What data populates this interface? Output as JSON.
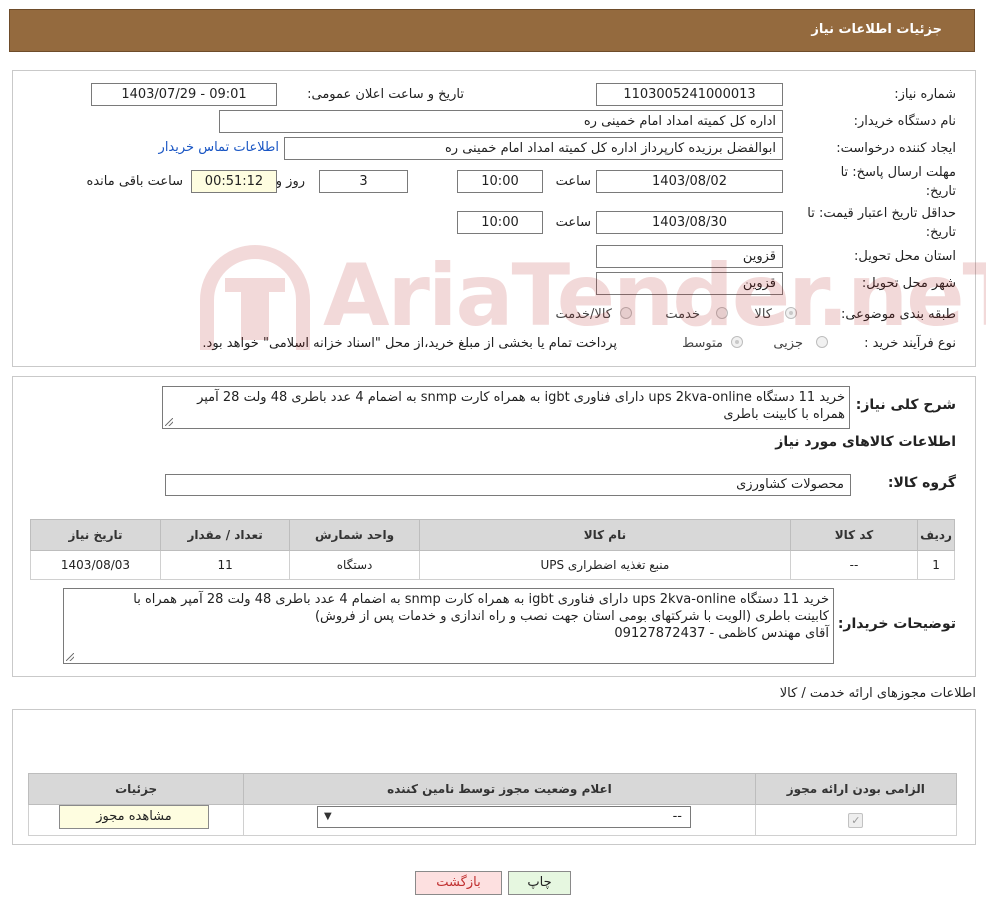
{
  "header": {
    "title": "جزئیات اطلاعات نیاز"
  },
  "need": {
    "need_number_label": "شماره نیاز:",
    "need_number": "1103005241000013",
    "announce_label": "تاریخ و ساعت اعلان عمومی:",
    "announce_value": "1403/07/29 - 09:01",
    "buyer_org_label": "نام دستگاه خریدار:",
    "buyer_org": "اداره کل کمیته امداد امام خمینی  ره",
    "creator_label": "ایجاد کننده درخواست:",
    "creator": "ابوالفضل برزیده کارپرداز اداره کل کمیته امداد امام خمینی  ره",
    "contact_link": "اطلاعات تماس خریدار",
    "deadline_label_1": "مهلت ارسال پاسخ: تا",
    "deadline_label_2": "تاریخ:",
    "deadline_date": "1403/08/02",
    "time_label": "ساعت",
    "deadline_time": "10:00",
    "days_value": "3",
    "days_label": "روز و",
    "remaining_value": "00:51:12",
    "remaining_label": "ساعت باقی مانده",
    "validity_label_1": "حداقل تاریخ اعتبار قیمت: تا",
    "validity_label_2": "تاریخ:",
    "validity_date": "1403/08/30",
    "validity_time": "10:00",
    "province_label": "استان محل تحویل:",
    "province": "قزوین",
    "city_label": "شهر محل تحویل:",
    "city": "قزوین",
    "category_label": "طبقه بندی موضوعی:",
    "category_options": [
      "کالا",
      "خدمت",
      "کالا/خدمت"
    ],
    "purchase_type_label": "نوع فرآیند خرید :",
    "purchase_type_options": [
      "جزیی",
      "متوسط"
    ],
    "purchase_note": "پرداخت تمام یا بخشی از مبلغ خرید،از محل \"اسناد خزانه اسلامی\" خواهد بود."
  },
  "summary": {
    "label": "شرح کلی نیاز:",
    "text": "خرید 11 دستگاه ups 2kva-online دارای فناوری igbt به همراه کارت snmp به اضمام 4 عدد باطری 48 ولت 28 آمپر همراه با کابینت باطری",
    "goods_info_title": "اطلاعات کالاهای مورد نیاز",
    "goods_group_label": "گروه کالا:",
    "goods_group": "محصولات کشاورزی"
  },
  "goods_table": {
    "headers": [
      "ردیف",
      "کد کالا",
      "نام کالا",
      "واحد شمارش",
      "تعداد / مقدار",
      "تاریخ نیاز"
    ],
    "rows": [
      [
        "1",
        "--",
        "منبع تغذیه اضطراری UPS",
        "دستگاه",
        "11",
        "1403/08/03"
      ]
    ]
  },
  "buyer_notes": {
    "label": "توضیحات خریدار:",
    "line1": "خرید 11 دستگاه ups 2kva-online دارای فناوری igbt به همراه کارت snmp به اضمام 4 عدد باطری 48 ولت 28 آمپر همراه با",
    "line2": "کابینت باطری (الویت با شرکتهای بومی استان جهت نصب و راه اندازی و خدمات پس از فروش)",
    "line3": "آقای مهندس کاظمی - 09127872437"
  },
  "licenses": {
    "title": "اطلاعات مجوزهای ارائه خدمت / کالا",
    "headers": [
      "الزامی بودن ارائه مجوز",
      "اعلام وضعیت مجوز توسط نامین کننده",
      "جزئیات"
    ],
    "select_value": "--",
    "view_button": "مشاهده مجوز"
  },
  "footer": {
    "print_button": "چاپ",
    "back_button": "بازگشت"
  },
  "watermark": {
    "text": "AriaTender.neT"
  },
  "colors": {
    "header_bg": "#946a3e",
    "link": "#1a56c4",
    "table_header": "#d8d8d8",
    "watermark": "#b01818"
  }
}
